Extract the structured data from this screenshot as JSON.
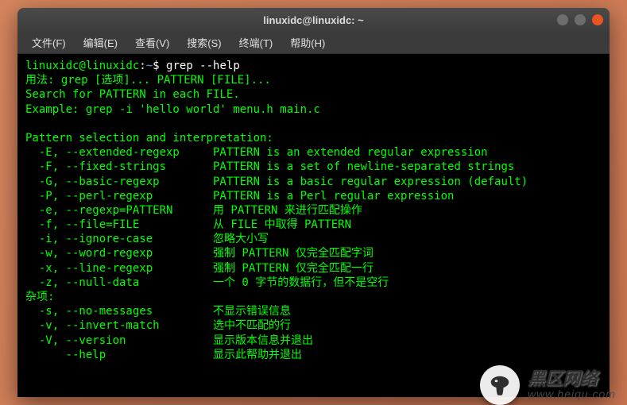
{
  "titlebar": {
    "title": "linuxidc@linuxidc: ~"
  },
  "menubar": {
    "items": [
      {
        "label": "文件(F)"
      },
      {
        "label": "编辑(E)"
      },
      {
        "label": "查看(V)"
      },
      {
        "label": "搜索(S)"
      },
      {
        "label": "终端(T)"
      },
      {
        "label": "帮助(H)"
      }
    ]
  },
  "prompt": {
    "userhost": "linuxidc@linuxidc",
    "colon": ":",
    "path": "~",
    "dollar": "$",
    "command": " grep --help"
  },
  "output": {
    "usage": "用法: grep [选项]... PATTERN [FILE]...",
    "desc": "Search for PATTERN in each FILE.",
    "example": "Example: grep -i 'hello world' menu.h main.c",
    "sect1": "Pattern selection and interpretation:",
    "options1": [
      {
        "flag": "  -E, --extended-regexp    ",
        "desc": " PATTERN is an extended regular expression"
      },
      {
        "flag": "  -F, --fixed-strings      ",
        "desc": " PATTERN is a set of newline-separated strings"
      },
      {
        "flag": "  -G, --basic-regexp       ",
        "desc": " PATTERN is a basic regular expression (default)"
      },
      {
        "flag": "  -P, --perl-regexp        ",
        "desc": " PATTERN is a Perl regular expression"
      },
      {
        "flag": "  -e, --regexp=PATTERN     ",
        "desc": " 用 PATTERN 来进行匹配操作"
      },
      {
        "flag": "  -f, --file=FILE          ",
        "desc": " 从 FILE 中取得 PATTERN"
      },
      {
        "flag": "  -i, --ignore-case        ",
        "desc": " 忽略大小写"
      },
      {
        "flag": "  -w, --word-regexp        ",
        "desc": " 强制 PATTERN 仅完全匹配字词"
      },
      {
        "flag": "  -x, --line-regexp        ",
        "desc": " 强制 PATTERN 仅完全匹配一行"
      },
      {
        "flag": "  -z, --null-data          ",
        "desc": " 一个 0 字节的数据行，但不是空行"
      }
    ],
    "sect2": "杂项:",
    "options2": [
      {
        "flag": "  -s, --no-messages        ",
        "desc": " 不显示错误信息"
      },
      {
        "flag": "  -v, --invert-match       ",
        "desc": " 选中不匹配的行"
      },
      {
        "flag": "  -V, --version            ",
        "desc": " 显示版本信息并退出"
      },
      {
        "flag": "      --help               ",
        "desc": " 显示此帮助并退出"
      }
    ]
  },
  "watermark": {
    "text_cn": "黑区网络",
    "url": "www.heiqu.com"
  }
}
